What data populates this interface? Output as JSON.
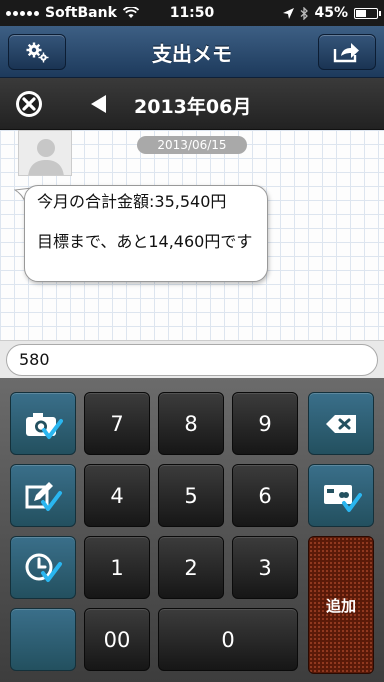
{
  "status_bar": {
    "carrier": "SoftBank",
    "time": "11:50",
    "battery": "45%",
    "battery_level": 0.45
  },
  "nav": {
    "title": "支出メモ",
    "settings_icon": "gear-icon",
    "share_icon": "share-icon"
  },
  "month_bar": {
    "month": "2013年06月",
    "close_icon": "close-icon",
    "prev_icon": "triangle-left-icon"
  },
  "chat": {
    "date": "2013/06/15",
    "message_line1": "今月の合計金額:35,540円",
    "message_line2": "目標まで、あと14,460円です"
  },
  "input": {
    "value": "580"
  },
  "keypad": {
    "keys": {
      "k7": "7",
      "k8": "8",
      "k9": "9",
      "k4": "4",
      "k5": "5",
      "k6": "6",
      "k1": "1",
      "k2": "2",
      "k3": "3",
      "k00": "00",
      "k0": "0"
    },
    "add_label": "追加",
    "colors": {
      "func": "#2f6275",
      "check": "#2ab6f0",
      "add": "#5a1a08"
    }
  }
}
